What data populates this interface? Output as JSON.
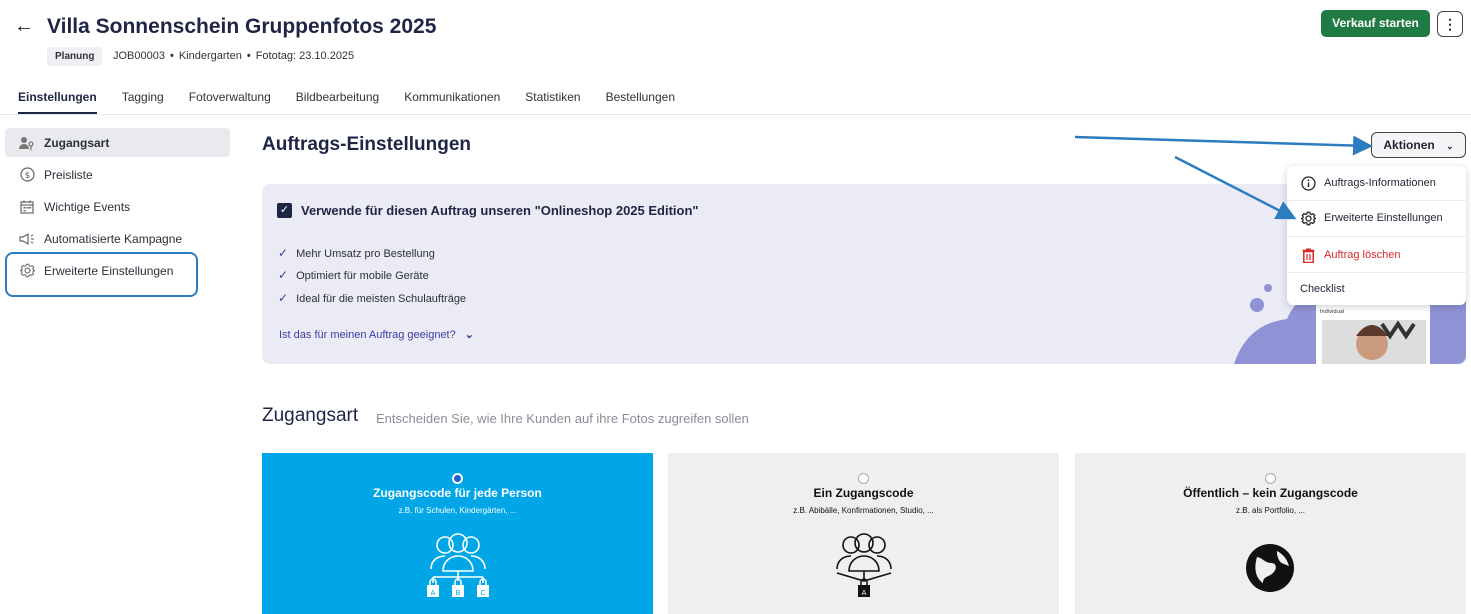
{
  "header": {
    "back_icon": "←",
    "title": "Villa Sonnenschein Gruppenfotos 2025",
    "status_badge": "Planung",
    "job_id": "JOB00003",
    "category": "Kindergarten",
    "photo_day": "Fototag: 23.10.2025",
    "start_sale_button": "Verkauf starten",
    "more_icon": "⋮"
  },
  "tabs": [
    {
      "label": "Einstellungen",
      "active": true
    },
    {
      "label": "Tagging"
    },
    {
      "label": "Fotoverwaltung"
    },
    {
      "label": "Bildbearbeitung"
    },
    {
      "label": "Kommunikationen"
    },
    {
      "label": "Statistiken"
    },
    {
      "label": "Bestellungen"
    }
  ],
  "sidebar": {
    "items": [
      {
        "label": "Zugangsart",
        "icon": "users-key-icon",
        "active": true
      },
      {
        "label": "Preisliste",
        "icon": "dollar-icon"
      },
      {
        "label": "Wichtige Events",
        "icon": "calendar-icon"
      },
      {
        "label": "Automatisierte Kampagne",
        "icon": "megaphone-icon"
      },
      {
        "label": "Erweiterte Einstellungen",
        "icon": "gear-icon"
      }
    ]
  },
  "main": {
    "title": "Auftrags-Einstellungen",
    "actions_button": "Aktionen",
    "panel": {
      "checkbox_label": "Verwende für diesen Auftrag unseren \"Onlineshop 2025 Edition\"",
      "features": [
        "Mehr Umsatz pro Bestellung",
        "Optimiert für mobile Geräte",
        "Ideal für die meisten Schulaufträge"
      ],
      "question_link": "Ist das für meinen Auftrag geeignet?"
    },
    "actions_menu": [
      {
        "label": "Auftrags-Informationen",
        "icon": "info-icon"
      },
      {
        "label": "Erweiterte Einstellungen",
        "icon": "gear-icon"
      },
      {
        "label": "Auftrag löschen",
        "icon": "trash-icon",
        "danger": true
      },
      {
        "label": "Checklist"
      }
    ],
    "section": {
      "title": "Zugangsart",
      "subtitle": "Entscheiden Sie, wie Ihre Kunden auf ihre Fotos zugreifen sollen"
    },
    "cards": [
      {
        "title": "Zugangscode für jede Person",
        "subtitle": "z.B. für Schulen, Kindergärten, ...",
        "selected": true,
        "icon": "group-multiple-codes-icon"
      },
      {
        "title": "Ein Zugangscode",
        "subtitle": "z.B. Abibälle, Konfirmationen, Studio, ...",
        "selected": false,
        "icon": "group-single-code-icon"
      },
      {
        "title": "Öffentlich – kein Zugangscode",
        "subtitle": "z.B. als Portfolio, ...",
        "selected": false,
        "icon": "globe-icon"
      }
    ]
  },
  "colors": {
    "primary_green": "#1f7a43",
    "accent_blue": "#00a6e6",
    "highlight_blue": "#2e7cc0",
    "danger_red": "#d52b2b",
    "panel_bg": "#ebebf6"
  }
}
